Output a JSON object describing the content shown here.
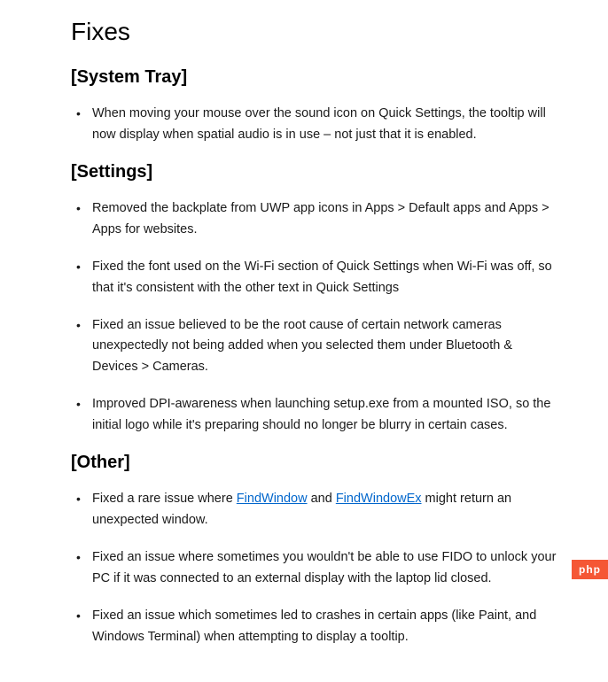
{
  "title": "Fixes",
  "sections": [
    {
      "heading": "[System Tray]",
      "items": [
        {
          "parts": [
            {
              "type": "text",
              "text": "When moving your mouse over the sound icon on Quick Settings, the tooltip will now display when spatial audio is in use – not just that it is enabled."
            }
          ]
        }
      ]
    },
    {
      "heading": "[Settings]",
      "items": [
        {
          "parts": [
            {
              "type": "text",
              "text": "Removed the backplate from UWP app icons in Apps > Default apps and Apps > Apps for websites."
            }
          ]
        },
        {
          "parts": [
            {
              "type": "text",
              "text": "Fixed the font used on the Wi-Fi section of Quick Settings when Wi-Fi was off, so that it's consistent with the other text in Quick Settings"
            }
          ]
        },
        {
          "parts": [
            {
              "type": "text",
              "text": "Fixed an issue believed to be the root cause of certain network cameras unexpectedly not being added when you selected them under Bluetooth & Devices > Cameras."
            }
          ]
        },
        {
          "parts": [
            {
              "type": "text",
              "text": "Improved DPI-awareness when launching setup.exe from a mounted ISO, so the initial logo while it's preparing should no longer be blurry in certain cases."
            }
          ]
        }
      ]
    },
    {
      "heading": "[Other]",
      "items": [
        {
          "parts": [
            {
              "type": "text",
              "text": "Fixed a rare issue where "
            },
            {
              "type": "link",
              "text": "FindWindow"
            },
            {
              "type": "text",
              "text": " and "
            },
            {
              "type": "link",
              "text": "FindWindowEx"
            },
            {
              "type": "text",
              "text": " might return an unexpected window."
            }
          ]
        },
        {
          "parts": [
            {
              "type": "text",
              "text": "Fixed an issue where sometimes you wouldn't be able to use FIDO to unlock your PC if it was connected to an external display with the laptop lid closed."
            }
          ]
        },
        {
          "parts": [
            {
              "type": "text",
              "text": "Fixed an issue which sometimes led to crashes in certain apps (like Paint, and Windows Terminal) when attempting to display a tooltip."
            }
          ]
        }
      ]
    }
  ],
  "watermark": "php"
}
